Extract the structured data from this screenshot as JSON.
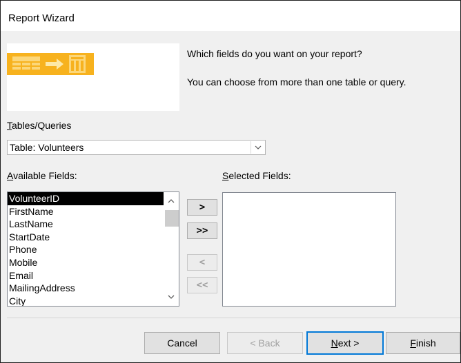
{
  "window": {
    "title": "Report Wizard"
  },
  "prompt": {
    "line1": "Which fields do you want on your report?",
    "line2": "You can choose from more than one table or query."
  },
  "tables_queries": {
    "label_accel": "T",
    "label_rest": "ables/Queries",
    "selected": "Table: Volunteers"
  },
  "available_fields": {
    "label_accel": "A",
    "label_rest": "vailable Fields:",
    "items": [
      "VolunteerID",
      "FirstName",
      "LastName",
      "StartDate",
      "Phone",
      "Mobile",
      "Email",
      "MailingAddress",
      "City"
    ],
    "selected_index": 0
  },
  "selected_fields": {
    "label_accel": "S",
    "label_rest": "elected Fields:",
    "items": []
  },
  "move_buttons": {
    "add_one": ">",
    "add_all": ">>",
    "remove_one": "<",
    "remove_all": "<<"
  },
  "footer": {
    "cancel": "Cancel",
    "back": "< Back",
    "next_accel": "N",
    "next_rest": "ext >",
    "finish_accel": "F",
    "finish_rest": "inish"
  },
  "colors": {
    "selection": "#000000",
    "default_button_border": "#0078d7",
    "graphic_orange": "#f7b21e"
  },
  "icons": [
    "report-wizard-graphic",
    "dropdown-chevron-icon",
    "scroll-up-icon",
    "scroll-down-icon"
  ]
}
